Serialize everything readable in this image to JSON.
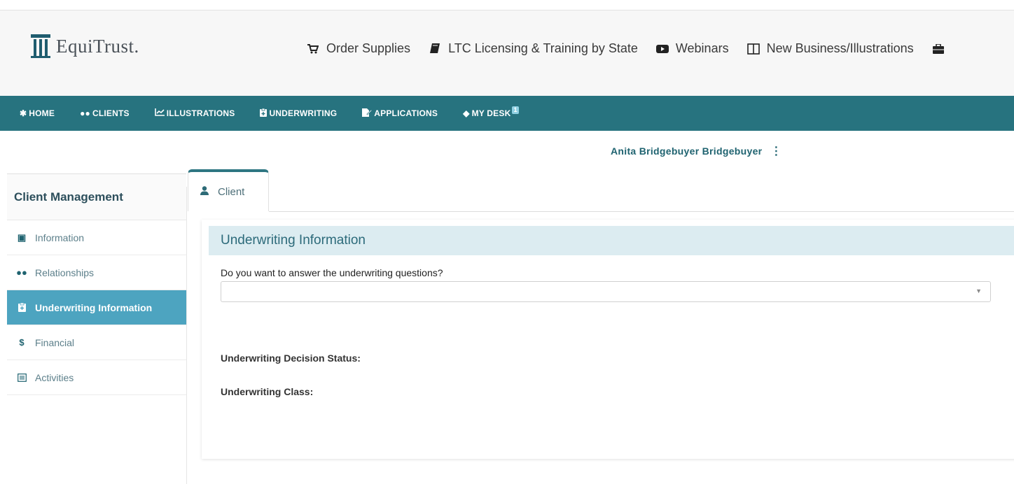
{
  "brand": {
    "name": "EquiTrust."
  },
  "utility_links": [
    {
      "icon": "cart-icon",
      "label": "Order Supplies"
    },
    {
      "icon": "book-icon",
      "label": "LTC Licensing & Training by State"
    },
    {
      "icon": "video-icon",
      "label": "Webinars"
    },
    {
      "icon": "columns-icon",
      "label": "New Business/Illustrations"
    },
    {
      "icon": "briefcase-icon",
      "label": ""
    }
  ],
  "nav": {
    "items": [
      {
        "icon": "home-icon",
        "label": "HOME"
      },
      {
        "icon": "users-icon",
        "label": "CLIENTS"
      },
      {
        "icon": "chart-line-icon",
        "label": "ILLUSTRATIONS"
      },
      {
        "icon": "clipboard-icon",
        "label": "UNDERWRITING"
      },
      {
        "icon": "file-edit-icon",
        "label": "APPLICATIONS"
      },
      {
        "icon": "layers-icon",
        "label": "MY DESK",
        "badge": "1"
      }
    ],
    "accent": "#27737f"
  },
  "user": {
    "name": "Anita Bridgebuyer Bridgebuyer"
  },
  "sidebar": {
    "title": "Client Management",
    "items": [
      {
        "icon": "id-card-icon",
        "label": "Information",
        "active": false
      },
      {
        "icon": "users-icon",
        "label": "Relationships",
        "active": false
      },
      {
        "icon": "clipboard-icon",
        "label": "Underwriting Information",
        "active": true
      },
      {
        "icon": "dollar-icon",
        "label": "Financial",
        "active": false
      },
      {
        "icon": "list-icon",
        "label": "Activities",
        "active": false
      }
    ],
    "active_color": "#4da4c0"
  },
  "tabs": [
    {
      "icon": "user-icon",
      "label": "Client"
    }
  ],
  "panel": {
    "header": "Underwriting Information",
    "question": "Do you want to answer the underwriting questions?",
    "select_value": "",
    "decision_status_label": "Underwriting Decision Status:",
    "class_label": "Underwriting Class:"
  }
}
